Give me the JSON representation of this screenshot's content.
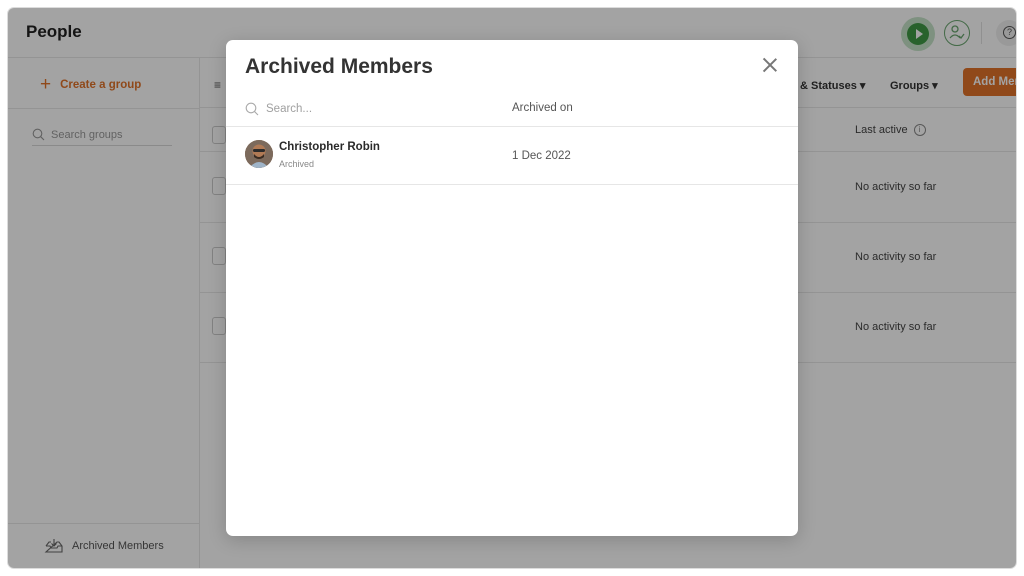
{
  "header": {
    "title": "People"
  },
  "sidebar": {
    "create_group_label": "Create a group",
    "search_placeholder": "Search groups",
    "archived_members_label": "Archived Members"
  },
  "toolbar": {
    "statuses_label": "& Statuses",
    "groups_label": "Groups",
    "add_button_label": "Add Mer"
  },
  "table": {
    "last_active_header": "Last active",
    "rows": [
      {
        "last_active": "No activity so far"
      },
      {
        "last_active": "No activity so far"
      },
      {
        "last_active": "No activity so far"
      }
    ]
  },
  "modal": {
    "title": "Archived Members",
    "search_placeholder": "Search...",
    "archived_on_header": "Archived on",
    "members": [
      {
        "name": "Christopher Robin",
        "status": "Archived",
        "archived_on": "1 Dec 2022"
      }
    ]
  },
  "colors": {
    "accent": "#e1732a",
    "play_green": "#3f9a46"
  }
}
